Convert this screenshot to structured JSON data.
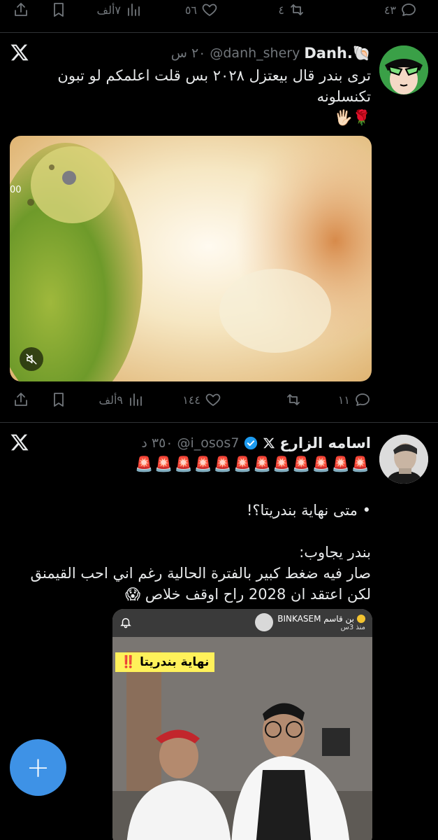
{
  "top_bar": {
    "replies": "٤٣",
    "retweets": "٤",
    "likes": "٥٦",
    "views": "٧ألف"
  },
  "tweet1": {
    "display_name": "Danh.🐚",
    "handle": "@danh_shery",
    "time": "٢٠ س",
    "text_line1": "ترى بندر قال بيعتزل ٢٠٢٨ بس قلت اعلمكم لو تبون",
    "text_line2": "تكنسلونه",
    "text_line3": "🌹🖐🏻",
    "video_timestamp": "00",
    "actions": {
      "replies": "١١",
      "retweets": "",
      "likes": "١٤٤",
      "views": "٩ألف"
    }
  },
  "tweet2": {
    "display_name": "اسامه الزارع",
    "handle": "@i_osos7",
    "time": "٣٥٠ د",
    "sirens": "🚨🚨🚨🚨🚨🚨🚨🚨🚨🚨🚨🚨",
    "line_question": "• متى نهاية بندريتا؟!",
    "line_answer_label": "بندر يجاوب:",
    "line_answer_1": "صار فيه ضغط كبير بالفترة الحالية رغم اني احب القيمنق",
    "line_answer_2": "لكن اعتقد ان 2028 راح اوقف خلاص 😱",
    "embed": {
      "account": "بن قاسم BINKASEM",
      "time": "منذ 3س",
      "banner": "نهاية بندريتا ‼️"
    }
  },
  "fab": {
    "label": "+"
  }
}
